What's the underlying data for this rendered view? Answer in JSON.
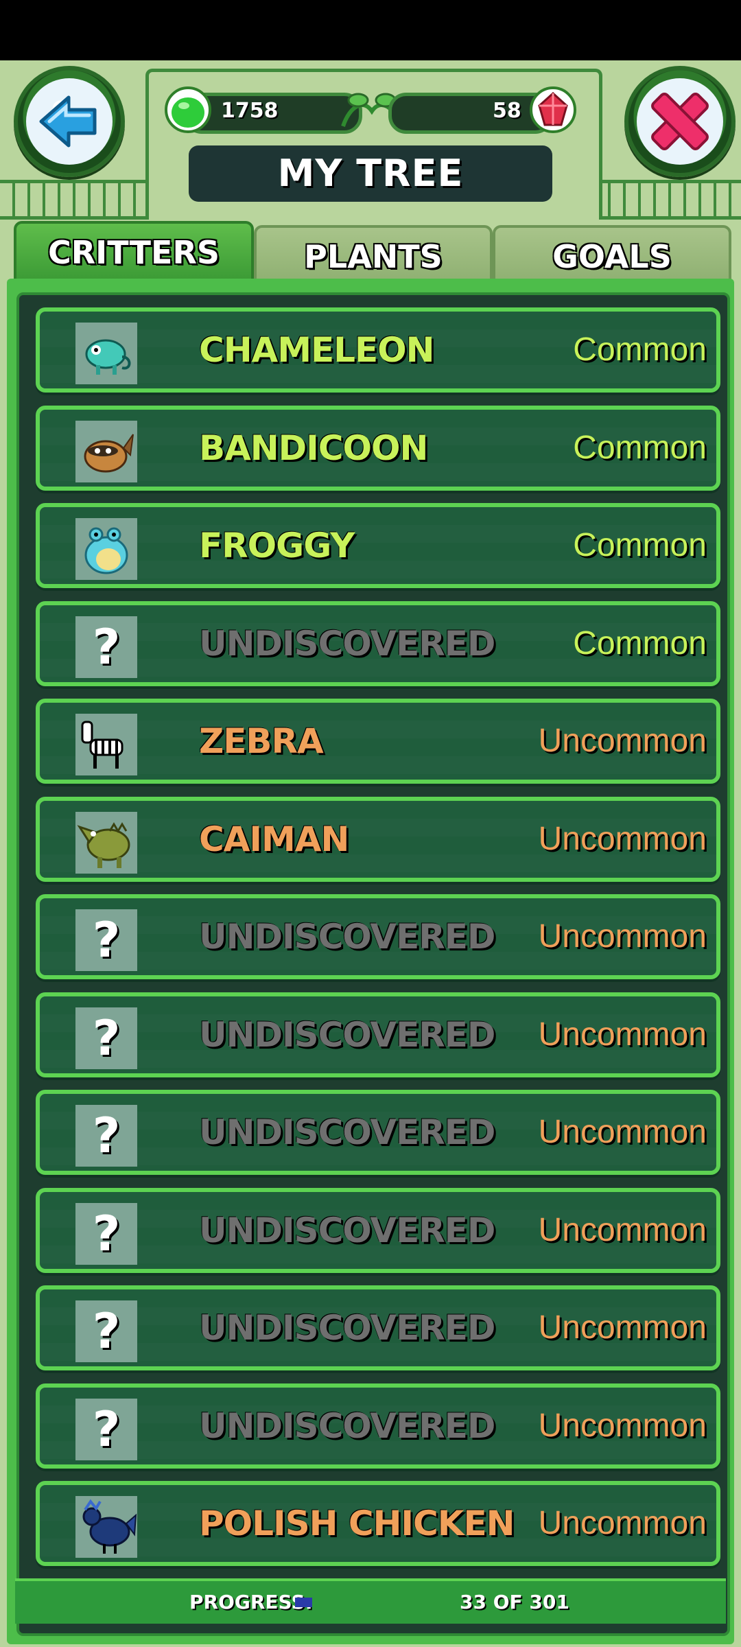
{
  "header": {
    "title": "MY TREE",
    "gel_count": "1758",
    "gem_count": "58"
  },
  "tabs": [
    {
      "label": "CRITTERS",
      "active": true
    },
    {
      "label": "PLANTS",
      "active": false
    },
    {
      "label": "GOALS",
      "active": false
    }
  ],
  "rows": [
    {
      "name": "CHAMELEON",
      "rarity": "Common",
      "discovered": true,
      "icon": "chameleon-icon"
    },
    {
      "name": "BANDICOON",
      "rarity": "Common",
      "discovered": true,
      "icon": "bandicoon-icon"
    },
    {
      "name": "FROGGY",
      "rarity": "Common",
      "discovered": true,
      "icon": "frog-icon"
    },
    {
      "name": "UNDISCOVERED",
      "rarity": "Common",
      "discovered": false,
      "icon": "question-mark-icon"
    },
    {
      "name": "ZEBRA",
      "rarity": "Uncommon",
      "discovered": true,
      "icon": "zebra-icon"
    },
    {
      "name": "CAIMAN",
      "rarity": "Uncommon",
      "discovered": true,
      "icon": "caiman-icon"
    },
    {
      "name": "UNDISCOVERED",
      "rarity": "Uncommon",
      "discovered": false,
      "icon": "question-mark-icon"
    },
    {
      "name": "UNDISCOVERED",
      "rarity": "Uncommon",
      "discovered": false,
      "icon": "question-mark-icon"
    },
    {
      "name": "UNDISCOVERED",
      "rarity": "Uncommon",
      "discovered": false,
      "icon": "question-mark-icon"
    },
    {
      "name": "UNDISCOVERED",
      "rarity": "Uncommon",
      "discovered": false,
      "icon": "question-mark-icon"
    },
    {
      "name": "UNDISCOVERED",
      "rarity": "Uncommon",
      "discovered": false,
      "icon": "question-mark-icon"
    },
    {
      "name": "UNDISCOVERED",
      "rarity": "Uncommon",
      "discovered": false,
      "icon": "question-mark-icon"
    },
    {
      "name": "POLISH CHICKEN",
      "rarity": "Uncommon",
      "discovered": true,
      "icon": "chicken-icon"
    }
  ],
  "footer": {
    "progress_label": "PROGRESS:",
    "progress_text": "33 OF 301",
    "progress_fraction": 0.11
  },
  "colors": {
    "common_name": "#c8f25a",
    "uncommon_name": "#f0a05a",
    "undiscovered_name": "#6f6f6f",
    "common_rarity": "#c8f25a",
    "uncommon_rarity": "#f0a05a"
  }
}
